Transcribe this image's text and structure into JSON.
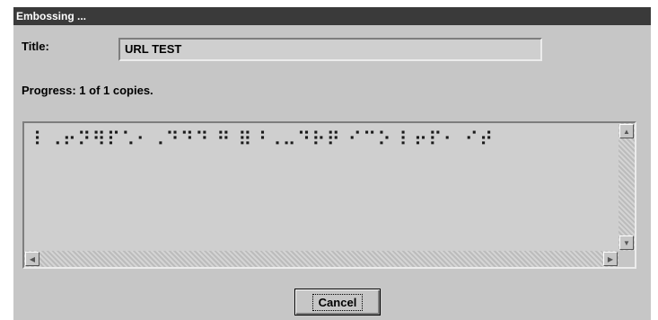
{
  "window": {
    "title": "Embossing ..."
  },
  "form": {
    "title_label": "Title:",
    "title_value": "URL TEST",
    "progress_text": "Progress: 1 of 1 copies."
  },
  "output": {
    "braille_text": "⠇⠠⠖⠝⠻⠏⠡⠂⠠⠙⠙⠙ ⠛ ⠿⠘⠠⠤⠙⠗⠟ ⠊⠉⠕ ⠇⠖⠏⠂ ⠊⠞",
    "scroll_up_icon": "scroll-up-icon",
    "scroll_down_icon": "scroll-down-icon",
    "scroll_left_icon": "scroll-left-icon",
    "scroll_right_icon": "scroll-right-icon"
  },
  "buttons": {
    "cancel_label": "Cancel"
  },
  "colors": {
    "dialog_bg": "#c6c6c6",
    "titlebar_bg": "#3a3a3a",
    "titlebar_text": "#ffffff"
  }
}
